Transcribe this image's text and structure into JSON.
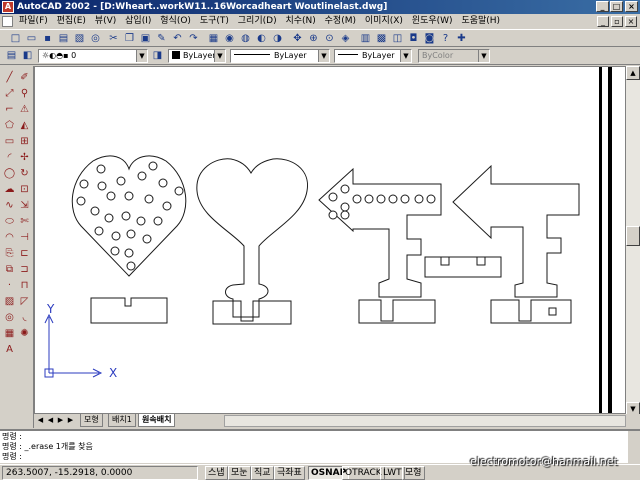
{
  "window": {
    "app_icon_text": "A",
    "title": "AutoCAD 2002 - [D:Wheart..workW11..16Worcadheart Woutlinelast.dwg]",
    "minimize": "_",
    "maximize": "□",
    "close": "×"
  },
  "menu": {
    "items": [
      "파일(F)",
      "편집(E)",
      "뷰(V)",
      "삽입(I)",
      "형식(O)",
      "도구(T)",
      "그리기(D)",
      "치수(N)",
      "수정(M)",
      "이미지(X)",
      "윈도우(W)",
      "도움말(H)"
    ]
  },
  "properties": {
    "layer": "0",
    "color": "ByLayer",
    "linetype": "ByLayer",
    "lineweight": "ByLayer",
    "plotstyle": "ByColor"
  },
  "ucs": {
    "x_label": "X",
    "y_label": "Y"
  },
  "tabs": [
    "모형",
    "배치1",
    "원속배치"
  ],
  "tab_nav": [
    "◀",
    "◀",
    "▶",
    "▶"
  ],
  "command": {
    "line1": "명령 :",
    "line2": "명령 : _.erase 1개를 찾음",
    "line3": "명령 :"
  },
  "status": {
    "coords": "263.5007, -15.2918, 0.0000",
    "buttons": [
      "스냅",
      "모눈",
      "직교",
      "극좌표",
      "OSNAP",
      "OTRACK",
      "LWT",
      "모형"
    ],
    "on_buttons": [
      "OSNAP"
    ]
  },
  "watermark": "electromotor@hanmail.net",
  "icons": {
    "app": "autocad-logo-icon",
    "toolbar": [
      "new-icon",
      "open-icon",
      "save-icon",
      "print-icon",
      "preview-icon",
      "find-icon",
      "cut-icon",
      "copy-icon",
      "paste-icon",
      "matchprop-icon",
      "undo-icon",
      "redo-icon",
      "today-icon",
      "browser-icon",
      "hyperlink-icon",
      "pan-icon",
      "zoom-icon"
    ]
  }
}
